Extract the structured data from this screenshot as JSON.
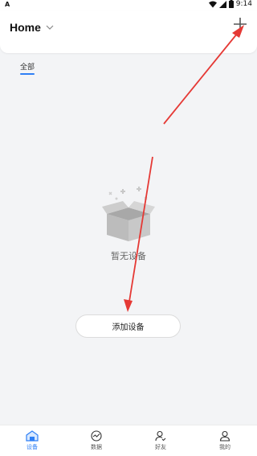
{
  "statusbar": {
    "left_glyph": "A",
    "time": "9:14"
  },
  "header": {
    "title": "Home",
    "chevron_icon": "chevron-down-icon",
    "add_icon": "plus-icon"
  },
  "tabs": [
    {
      "label": "全部",
      "active": true
    }
  ],
  "empty_state": {
    "icon": "empty-box-icon",
    "text": "暂无设备"
  },
  "add_device_button": {
    "label": "添加设备"
  },
  "bottom_nav": [
    {
      "label": "设备",
      "icon": "home-device-icon",
      "active": true
    },
    {
      "label": "数据",
      "icon": "data-chart-icon",
      "active": false
    },
    {
      "label": "好友",
      "icon": "friends-icon",
      "active": false
    },
    {
      "label": "我的",
      "icon": "profile-icon",
      "active": false
    }
  ],
  "colors": {
    "accent": "#2e7ff5",
    "annotation_arrow": "#e53935",
    "background": "#f3f4f6"
  }
}
